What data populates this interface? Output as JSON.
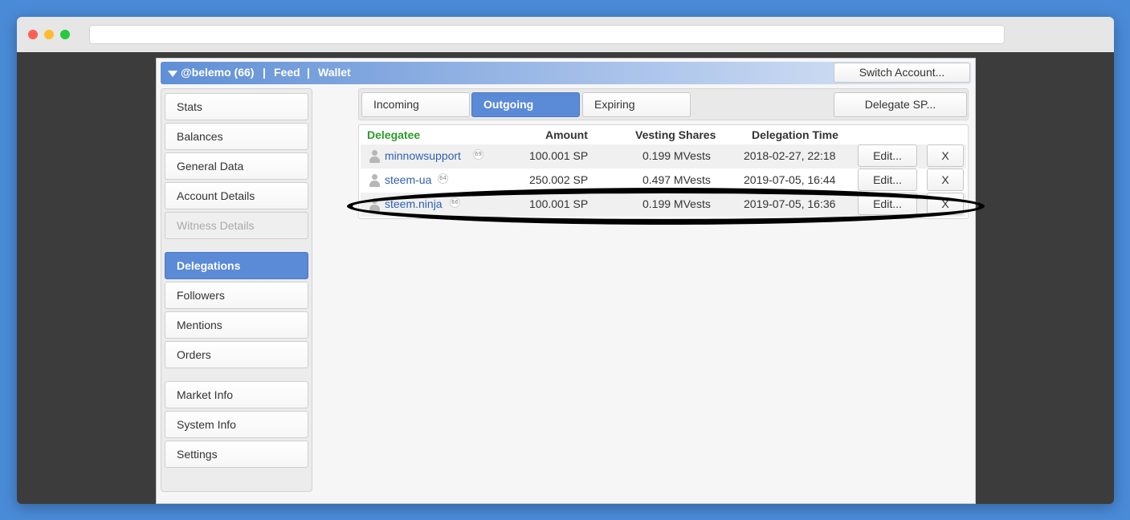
{
  "header": {
    "account": "@belemo (66)",
    "sep1": "|",
    "feed": "Feed",
    "sep2": "|",
    "wallet": "Wallet",
    "switch_account": "Switch Account..."
  },
  "sidebar": {
    "items": [
      {
        "label": "Stats"
      },
      {
        "label": "Balances"
      },
      {
        "label": "General Data"
      },
      {
        "label": "Account Details"
      },
      {
        "label": "Witness Details"
      },
      {
        "label": "Delegations"
      },
      {
        "label": "Followers"
      },
      {
        "label": "Mentions"
      },
      {
        "label": "Orders"
      },
      {
        "label": "Market Info"
      },
      {
        "label": "System Info"
      },
      {
        "label": "Settings"
      }
    ]
  },
  "tabs": {
    "incoming": "Incoming",
    "outgoing": "Outgoing",
    "expiring": "Expiring",
    "delegate": "Delegate SP..."
  },
  "table": {
    "headers": {
      "delegatee": "Delegatee",
      "amount": "Amount",
      "vesting": "Vesting Shares",
      "time": "Delegation Time"
    },
    "rows": [
      {
        "user": "minnowsupport",
        "rep": "69",
        "amount": "100.001 SP",
        "vesting": "0.199 MVests",
        "time": "2018-02-27, 22:18",
        "edit": "Edit...",
        "remove": "X"
      },
      {
        "user": "steem-ua",
        "rep": "64",
        "amount": "250.002 SP",
        "vesting": "0.497 MVests",
        "time": "2019-07-05, 16:44",
        "edit": "Edit...",
        "remove": "X"
      },
      {
        "user": "steem.ninja",
        "rep": "66",
        "amount": "100.001 SP",
        "vesting": "0.199 MVests",
        "time": "2019-07-05, 16:36",
        "edit": "Edit...",
        "remove": "X"
      }
    ]
  },
  "colors": {
    "accent": "#5b8ad6",
    "delegatee_header": "#2a9d2a",
    "link": "#2f5fb3"
  }
}
